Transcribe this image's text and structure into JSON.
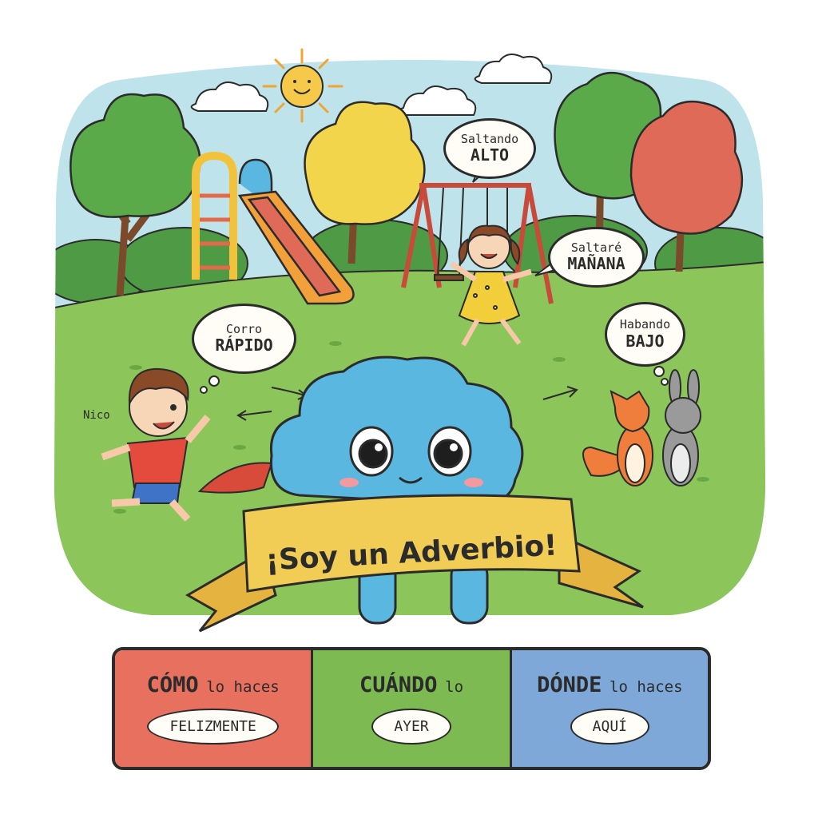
{
  "scene": {
    "bubbles": [
      {
        "line1": "Saltando",
        "line2": "ALTO"
      },
      {
        "line1": "Saltaré",
        "line2": "MAÑANA"
      },
      {
        "line1": "Corro",
        "line2": "RÁPIDO"
      },
      {
        "line1": "Habando",
        "line2": "BAJO"
      }
    ],
    "character_name": "Nico",
    "banner": "¡Soy un Adverbio!"
  },
  "panel": {
    "cells": [
      {
        "word": "CÓMO",
        "rest": "lo haces",
        "example": "FELIZMENTE",
        "color": "#e8705e"
      },
      {
        "word": "CUÁNDO",
        "rest": "lo",
        "example": "AYER",
        "color": "#7dbb52"
      },
      {
        "word": "DÓNDE",
        "rest": "lo haces",
        "example": "AQUÍ",
        "color": "#7da8d8"
      }
    ]
  },
  "colors": {
    "sky": "#bfe3ea",
    "grass": "#8cc65a",
    "cloud_character": "#5ab8e0",
    "banner": "#f2cd55"
  }
}
